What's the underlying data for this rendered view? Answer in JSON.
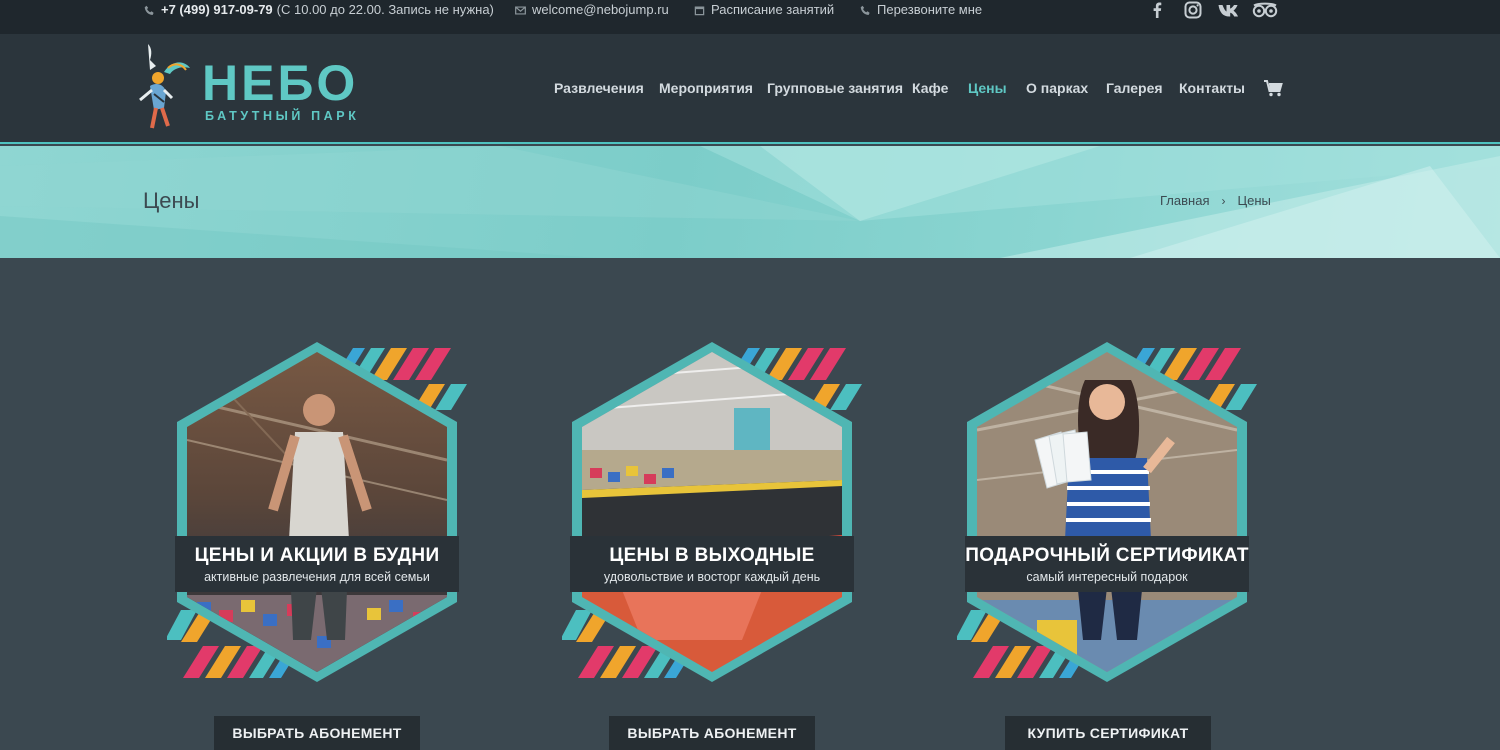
{
  "topbar": {
    "phone": "+7 (499) 917-09-79",
    "phone_note": "(С 10.00 до 22.00. Запись не нужна)",
    "email": "welcome@nebojump.ru",
    "schedule": "Расписание занятий",
    "callback": "Перезвоните мне",
    "social_icons": [
      "facebook-icon",
      "instagram-icon",
      "vk-icon",
      "tripadvisor-icon"
    ]
  },
  "logo": {
    "title": "НЕБО",
    "subtitle": "БАТУТНЫЙ ПАРК"
  },
  "nav": {
    "items": [
      {
        "label": "Развлечения",
        "active": false
      },
      {
        "label": "Мероприятия",
        "active": false
      },
      {
        "label": "Групповые занятия",
        "active": false
      },
      {
        "label": "Кафе",
        "active": false
      },
      {
        "label": "Цены",
        "active": true
      },
      {
        "label": "О парках",
        "active": false
      },
      {
        "label": "Галерея",
        "active": false
      },
      {
        "label": "Контакты",
        "active": false
      }
    ],
    "cart_icon": "cart-icon"
  },
  "page": {
    "title": "Цены",
    "breadcrumb": {
      "home": "Главная",
      "separator": "›",
      "current": "Цены"
    }
  },
  "cards": [
    {
      "title": "ЦЕНЫ И АКЦИИ В БУДНИ",
      "subtitle": "активные развлечения для всей семьи",
      "button": "ВЫБРАТЬ АБОНЕМЕНТ"
    },
    {
      "title": "ЦЕНЫ В ВЫХОДНЫЕ",
      "subtitle": "удовольствие и восторг каждый день",
      "button": "ВЫБРАТЬ АБОНЕМЕНТ"
    },
    {
      "title": "ПОДАРОЧНЫЙ СЕРТИФИКАТ",
      "subtitle": "самый интересный подарок",
      "button": "КУПИТЬ СЕРТИФИКАТ"
    }
  ],
  "colors": {
    "accent": "#5fc8c4",
    "topbar_bg": "#1f272d",
    "header_bg": "#2b353c",
    "body_bg": "#3b4850",
    "button_bg": "#262e33",
    "stripe_colors": [
      "#e23a6a",
      "#f0a52c",
      "#4cbfc0",
      "#3aa6d6"
    ]
  }
}
